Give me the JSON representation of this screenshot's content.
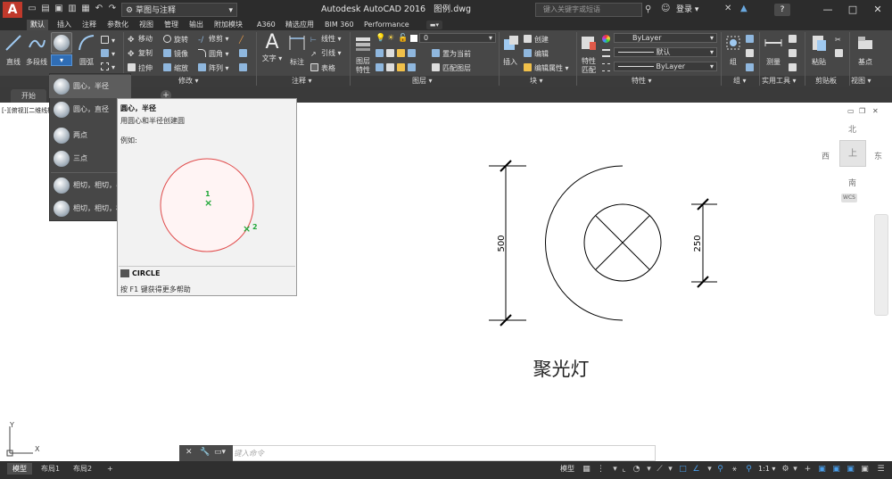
{
  "titlebar": {
    "workspace": "草图与注释",
    "app_title": "Autodesk AutoCAD 2016",
    "file_name": "图例.dwg",
    "search_placeholder": "键入关键字或短语",
    "signin": "登录",
    "help": "?",
    "controls": {
      "minimize": "—",
      "maximize": "□",
      "close": "✕"
    }
  },
  "ribbon_tabs": [
    "默认",
    "插入",
    "注释",
    "参数化",
    "视图",
    "管理",
    "输出",
    "附加模块",
    "A360",
    "精选应用",
    "BIM 360",
    "Performance"
  ],
  "ribbon": {
    "draw": {
      "line": "直线",
      "polyline": "多段线",
      "circle": "圆",
      "arc": "圆弧"
    },
    "modify": {
      "move": "移动",
      "rotate": "旋转",
      "trim": "修剪",
      "copy": "复制",
      "mirror": "镜像",
      "fillet": "圆角",
      "stretch": "拉伸",
      "scale": "缩放",
      "array": "阵列"
    },
    "annotation": {
      "text": "文字",
      "dimension": "标注",
      "linear": "线性",
      "leader": "引线",
      "table": "表格"
    },
    "layers": {
      "layer_properties": "图层特性",
      "current_layer": "0",
      "set_current": "置为当前",
      "match_layer": "匹配图层"
    },
    "block": {
      "insert": "插入",
      "create": "创建",
      "edit": "编辑",
      "edit_attributes": "编辑属性"
    },
    "properties": {
      "match_properties": "特性匹配",
      "color": "ByLayer",
      "lineweight": "默认",
      "linetype": "ByLayer"
    },
    "groups": {
      "group": "组"
    },
    "utilities": {
      "measure": "测量"
    },
    "clipboard": {
      "paste": "粘贴"
    },
    "view": {
      "base": "基点"
    },
    "panel_titles": [
      "修改 ▾",
      "注释 ▾",
      "图层 ▾",
      "块 ▾",
      "特性 ▾",
      "组 ▾",
      "实用工具 ▾",
      "剪贴板",
      "视图 ▾"
    ]
  },
  "file_tabs": {
    "start": "开始",
    "add": "+"
  },
  "view_label": "[-][俯视][二维线框]",
  "circle_menu": {
    "items": [
      "圆心，半径",
      "圆心，直径",
      "两点",
      "三点",
      "相切，相切，半径",
      "相切，相切，相切"
    ]
  },
  "tooltip": {
    "title": "圆心，半径",
    "description": "用圆心和半径创建圆",
    "example_label": "例如:",
    "point1": "1",
    "point2": "2",
    "command": "CIRCLE",
    "help": "按 F1 键获得更多帮助"
  },
  "drawing": {
    "dim_left": "500",
    "dim_right": "250",
    "caption": "聚光灯"
  },
  "viewcube": {
    "north": "北",
    "south": "南",
    "east": "东",
    "west": "西",
    "top": "上",
    "wcs": "WCS"
  },
  "ucs": {
    "x": "X",
    "y": "Y"
  },
  "command_line": {
    "placeholder": "键入命令"
  },
  "layout_tabs": [
    "模型",
    "布局1",
    "布局2",
    "+"
  ],
  "status": {
    "model": "模型",
    "scale": "1:1"
  }
}
